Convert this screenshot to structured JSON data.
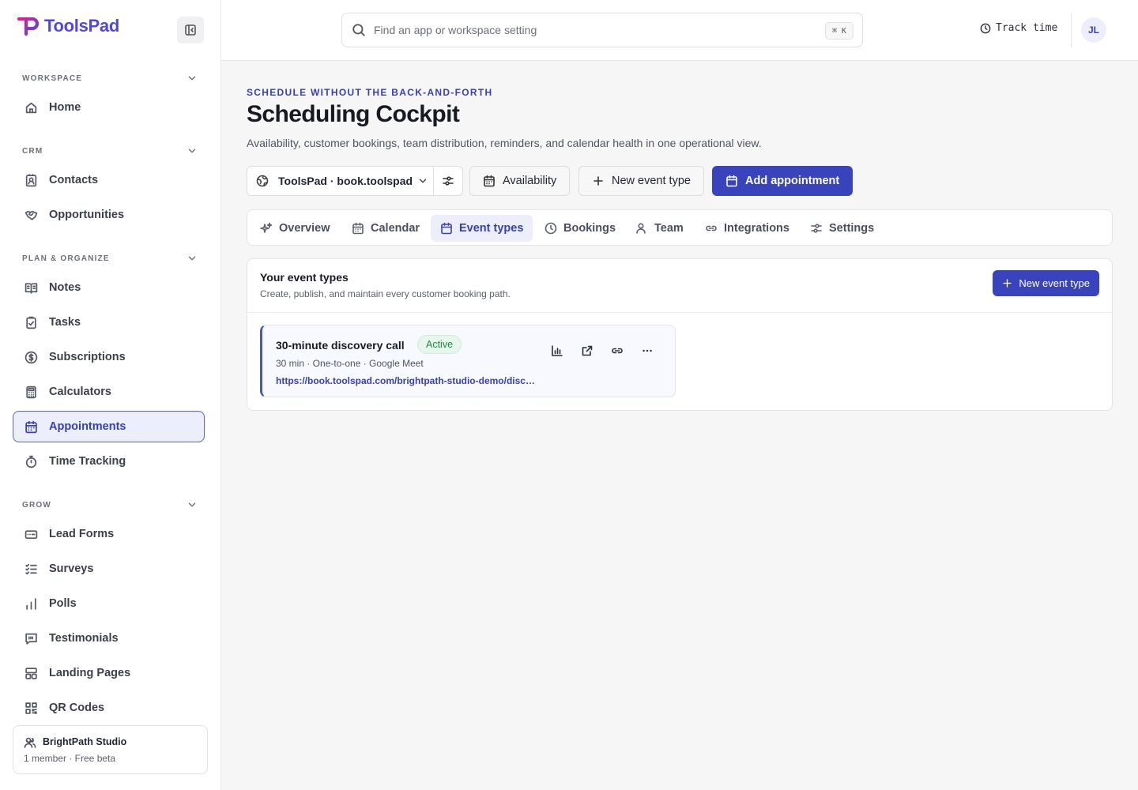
{
  "app": {
    "name": "ToolsPad"
  },
  "sidebar": {
    "sections": [
      {
        "label": "WORKSPACE",
        "items": [
          {
            "label": "Home",
            "icon": "home-icon"
          }
        ]
      },
      {
        "label": "CRM",
        "items": [
          {
            "label": "Contacts",
            "icon": "contact-card-icon"
          },
          {
            "label": "Opportunities",
            "icon": "handshake-icon"
          }
        ]
      },
      {
        "label": "PLAN & ORGANIZE",
        "items": [
          {
            "label": "Notes",
            "icon": "book-icon"
          },
          {
            "label": "Tasks",
            "icon": "clipboard-check-icon"
          },
          {
            "label": "Subscriptions",
            "icon": "dollar-circle-icon"
          },
          {
            "label": "Calculators",
            "icon": "calculator-icon"
          },
          {
            "label": "Appointments",
            "icon": "calendar-icon",
            "active": true
          },
          {
            "label": "Time Tracking",
            "icon": "stopwatch-icon"
          }
        ]
      },
      {
        "label": "GROW",
        "items": [
          {
            "label": "Lead Forms",
            "icon": "form-icon"
          },
          {
            "label": "Surveys",
            "icon": "checklist-icon"
          },
          {
            "label": "Polls",
            "icon": "bar-chart-icon"
          },
          {
            "label": "Testimonials",
            "icon": "quote-bubble-icon"
          },
          {
            "label": "Landing Pages",
            "icon": "layout-icon"
          },
          {
            "label": "QR Codes",
            "icon": "qr-code-icon"
          }
        ]
      }
    ],
    "org": {
      "name": "BrightPath Studio",
      "meta": "1 member · Free beta"
    }
  },
  "topbar": {
    "search_placeholder": "Find an app or workspace setting",
    "shortcut": "⌘ K",
    "track_time": "Track time",
    "avatar_initials": "JL"
  },
  "page": {
    "eyebrow": "SCHEDULE WITHOUT THE BACK-AND-FORTH",
    "title": "Scheduling Cockpit",
    "description": "Availability, customer bookings, team distribution, reminders, and calendar health in one operational view."
  },
  "toolbar": {
    "site_selector": "ToolsPad · book.toolspad",
    "availability": "Availability",
    "new_event_type": "New event type",
    "add_appointment": "Add appointment"
  },
  "tabs": [
    {
      "label": "Overview",
      "icon": "sparkles-icon"
    },
    {
      "label": "Calendar",
      "icon": "calendar-icon"
    },
    {
      "label": "Event types",
      "icon": "calendar-icon",
      "active": true
    },
    {
      "label": "Bookings",
      "icon": "clock-icon"
    },
    {
      "label": "Team",
      "icon": "users-icon"
    },
    {
      "label": "Integrations",
      "icon": "link-icon"
    },
    {
      "label": "Settings",
      "icon": "sliders-icon"
    }
  ],
  "event_types_panel": {
    "title": "Your event types",
    "subtitle": "Create, publish, and maintain every customer booking path.",
    "new_button": "New event type",
    "events": [
      {
        "title": "30-minute discovery call",
        "status": "Active",
        "meta": "30 min · One-to-one · Google Meet",
        "url": "https://book.toolspad.com/brightpath-studio-demo/discovery-call"
      }
    ]
  },
  "colors": {
    "accent": "#3944bc",
    "active_bg": "#eceefb",
    "success": "#1f8a46"
  }
}
